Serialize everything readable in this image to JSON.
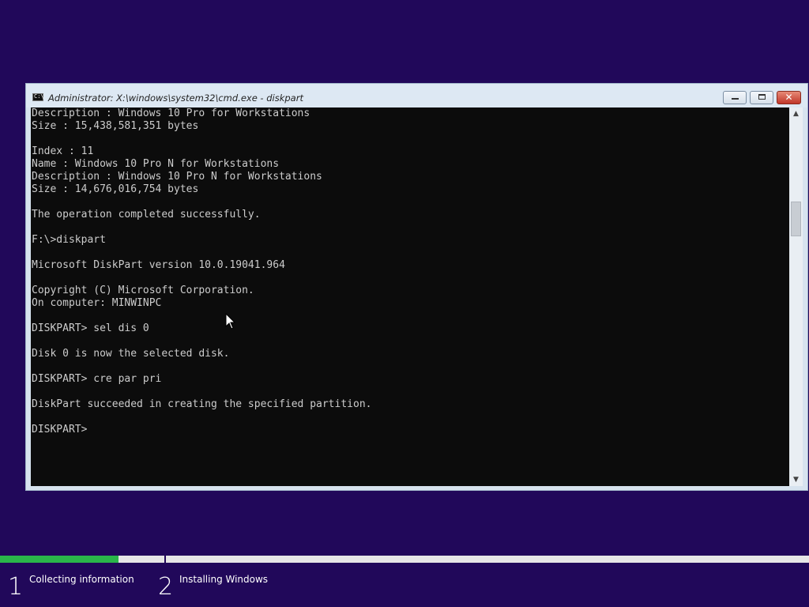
{
  "window": {
    "title": "Administrator: X:\\windows\\system32\\cmd.exe - diskpart",
    "icon_label": "C:\\",
    "close_glyph": "✕"
  },
  "console": {
    "lines": [
      "Description : Windows 10 Pro for Workstations",
      "Size : 15,438,581,351 bytes",
      "",
      "Index : 11",
      "Name : Windows 10 Pro N for Workstations",
      "Description : Windows 10 Pro N for Workstations",
      "Size : 14,676,016,754 bytes",
      "",
      "The operation completed successfully.",
      "",
      "F:\\>diskpart",
      "",
      "Microsoft DiskPart version 10.0.19041.964",
      "",
      "Copyright (C) Microsoft Corporation.",
      "On computer: MINWINPC",
      "",
      "DISKPART> sel dis 0",
      "",
      "Disk 0 is now the selected disk.",
      "",
      "DISKPART> cre par pri",
      "",
      "DiskPart succeeded in creating the specified partition.",
      "",
      "DISKPART> "
    ],
    "background_color": "#0c0c0c",
    "text_color": "#cccccc"
  },
  "scrollbar": {
    "up_arrow": "▲",
    "down_arrow": "▼"
  },
  "setup": {
    "progress_fraction": 0.146,
    "progress_color": "#2ab64a",
    "background_color": "#21085a",
    "steps": [
      {
        "number": "1",
        "label": "Collecting information"
      },
      {
        "number": "2",
        "label": "Installing Windows"
      }
    ]
  }
}
